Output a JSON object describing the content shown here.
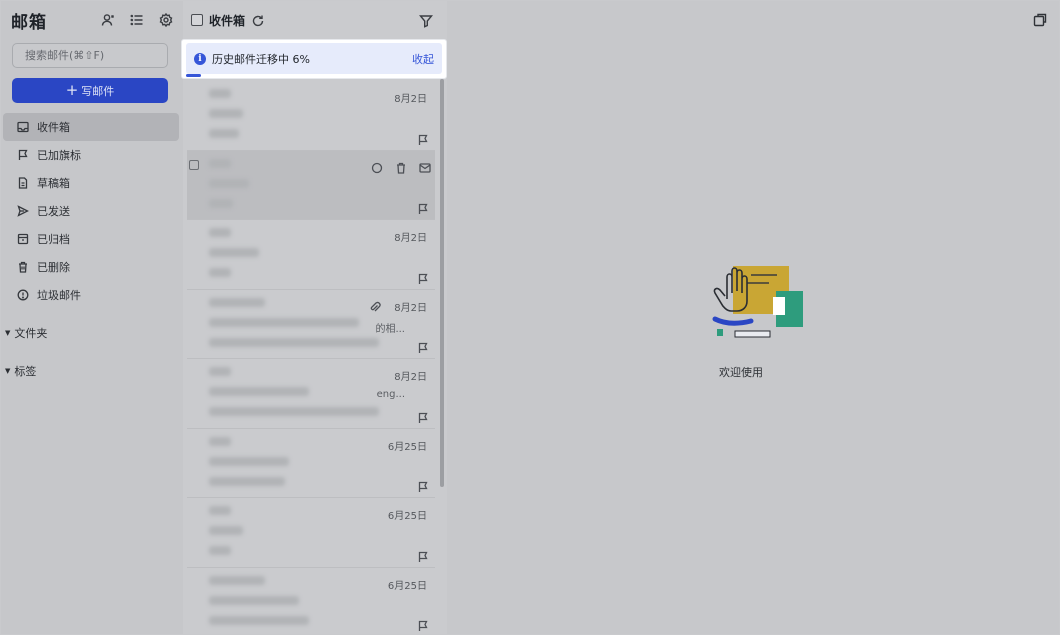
{
  "sidebar": {
    "title": "邮箱",
    "search_placeholder": "搜索邮件(⌘⇧F)",
    "compose_label": "写邮件",
    "nav": [
      {
        "label": "收件箱",
        "icon": "inbox-icon",
        "active": true
      },
      {
        "label": "已加旗标",
        "icon": "flag-icon"
      },
      {
        "label": "草稿箱",
        "icon": "draft-icon"
      },
      {
        "label": "已发送",
        "icon": "send-icon"
      },
      {
        "label": "已归档",
        "icon": "archive-icon"
      },
      {
        "label": "已删除",
        "icon": "trash-icon"
      },
      {
        "label": "垃圾邮件",
        "icon": "spam-icon"
      }
    ],
    "groups": [
      "文件夹",
      "标签"
    ]
  },
  "list": {
    "title": "收件箱",
    "banner": {
      "text": "历史邮件迁移中 6%",
      "link": "收起",
      "progress_percent": 6
    },
    "mails": [
      {
        "date": "8月2日",
        "tail": ""
      },
      {
        "date": "",
        "tail": ""
      },
      {
        "date": "8月2日",
        "tail": ""
      },
      {
        "date": "8月2日",
        "tail": "的相...",
        "attachment": true
      },
      {
        "date": "8月2日",
        "tail": "eng..."
      },
      {
        "date": "6月25日",
        "tail": ""
      },
      {
        "date": "6月25日",
        "tail": ""
      },
      {
        "date": "6月25日",
        "tail": ""
      }
    ]
  },
  "reader": {
    "welcome_text": "欢迎使用"
  },
  "colors": {
    "accent": "#3656d8",
    "compose_bg": "#2a46c4",
    "banner_bg": "#e6ebfb"
  }
}
